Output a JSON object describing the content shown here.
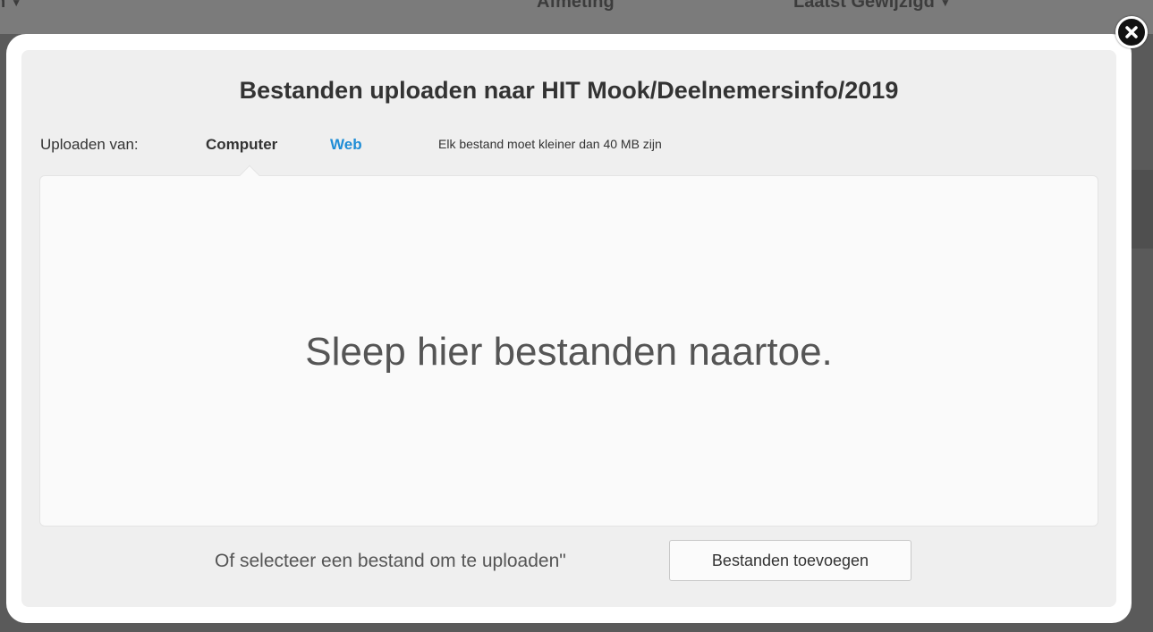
{
  "background": {
    "columns": [
      {
        "label": "n",
        "caret": "▼"
      },
      {
        "label": "Afmeting",
        "caret": ""
      },
      {
        "label": "Laatst Gewijzigd",
        "caret": "▼"
      }
    ]
  },
  "dialog": {
    "title": "Bestanden uploaden naar HIT Mook/Deelnemersinfo/2019",
    "upload_from_label": "Uploaden van:",
    "tabs": [
      {
        "label": "Computer",
        "active": true
      },
      {
        "label": "Web",
        "active": false
      }
    ],
    "size_note": "Elk bestand moet kleiner dan 40 MB zijn",
    "dropzone_text": "Sleep hier bestanden naartoe.",
    "select_text": "Of selecteer een bestand om te uploaden\"",
    "add_button_label": "Bestanden toevoegen",
    "close_icon": "close-icon"
  },
  "colors": {
    "accent": "#1f8dd6",
    "overlay": "#5a5a5a",
    "dialog_bg": "#efefef"
  }
}
